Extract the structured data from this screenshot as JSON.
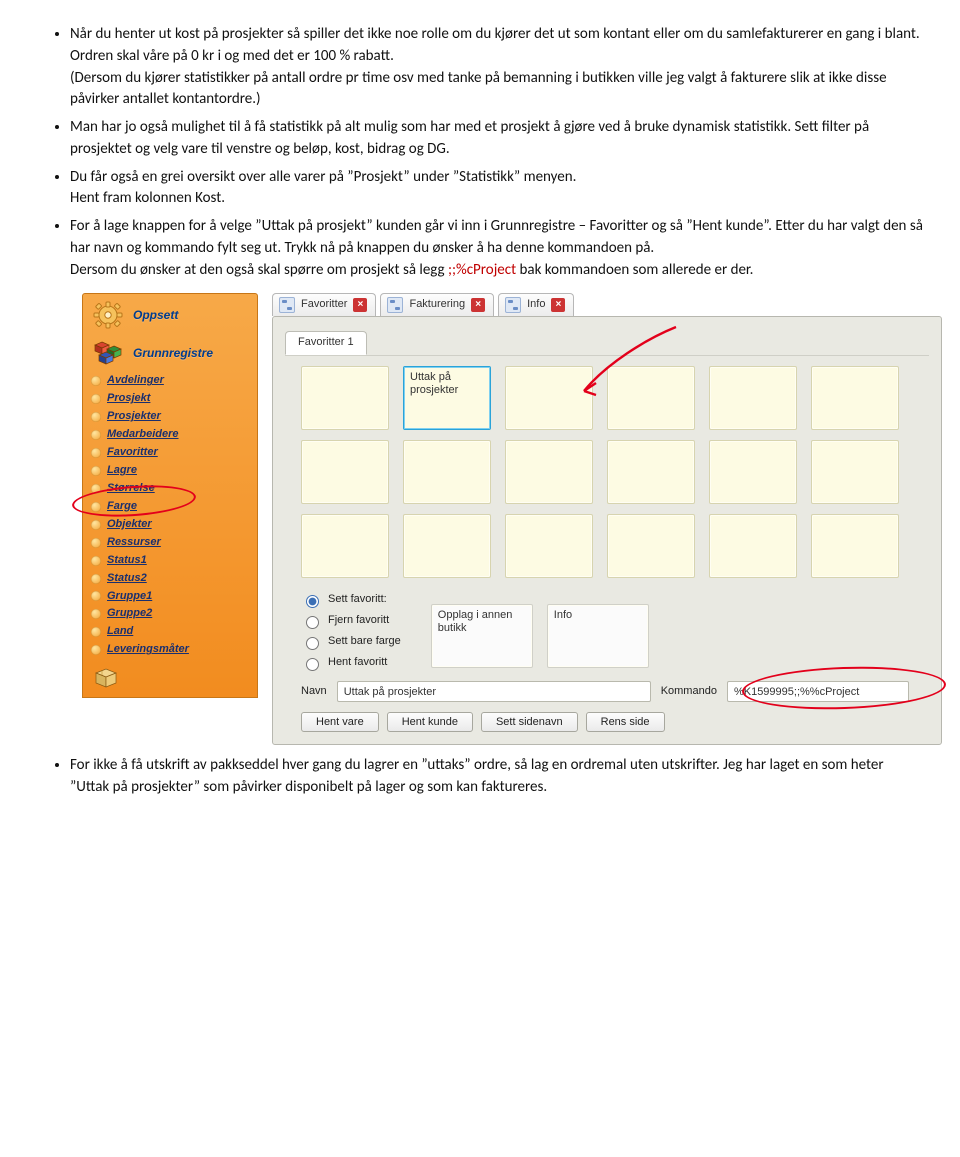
{
  "bullets": {
    "b1_p1": "Når du henter ut kost på prosjekter så spiller det ikke noe rolle om du kjører det ut som kontant eller om du samlefakturerer en gang i blant. Ordren skal våre på 0 kr i og med det er 100 % rabatt.",
    "b1_p2": "(Dersom du kjører statistikker på antall ordre pr time osv med tanke på bemanning i butikken ville jeg valgt å fakturere slik at ikke disse påvirker antallet kontantordre.)",
    "b2": "Man har jo også mulighet til å få statistikk på alt mulig som har med et prosjekt å gjøre ved å bruke dynamisk statistikk. Sett filter på prosjektet og velg vare til venstre og beløp, kost, bidrag og DG.",
    "b3_p1": "Du får også en grei oversikt over alle varer på ”Prosjekt” under ”Statistikk” menyen.",
    "b3_p2": "Hent fram kolonnen Kost.",
    "b4_p1": "For å lage knappen for å velge ”Uttak på prosjekt” kunden går vi  inn i Grunnregistre – Favoritter og så ”Hent kunde”. Etter du har valgt den så har navn og kommando fylt seg ut. Trykk nå på knappen du ønsker å ha denne kommandoen på.",
    "b4_p2a": "Dersom du ønsker at den også skal spørre om prosjekt så legg ",
    "b4_p2b": ";;%cProject",
    "b4_p2c": " bak kommandoen som allerede er der.",
    "b_last": "For ikke å få utskrift av pakkseddel hver gang du lagrer en ”uttaks” ordre, så lag en ordremal uten utskrifter. Jeg har laget en som heter ”Uttak på prosjekter” som påvirker disponibelt på lager og som kan faktureres."
  },
  "sidebar": {
    "oppsett": "Oppsett",
    "grunnregistre": "Grunnregistre",
    "items": [
      "Avdelinger",
      "Prosjekt",
      "Prosjekter",
      "Medarbeidere",
      "Favoritter",
      "Lagre",
      "Størrelse",
      "Farge",
      "Objekter",
      "Ressurser",
      "Status1",
      "Status2",
      "Gruppe1",
      "Gruppe2",
      "Land",
      "Leveringsmåter"
    ]
  },
  "tabs": {
    "t1": "Favoritter",
    "t2": "Fakturering",
    "t3": "Info"
  },
  "subtab": "Favoritter 1",
  "cells": {
    "sel": "Uttak på prosjekter",
    "opplag": "Opplag i annen butikk",
    "info": "Info"
  },
  "radios": {
    "r1": "Sett favoritt:",
    "r2": "Fjern favoritt",
    "r3": "Sett bare farge",
    "r4": "Hent favoritt"
  },
  "labels": {
    "navn": "Navn",
    "kommando": "Kommando"
  },
  "inputs": {
    "navn": "Uttak på prosjekter",
    "kommando": "%K1599995;;%%cProject"
  },
  "buttons": {
    "b1": "Hent vare",
    "b2": "Hent kunde",
    "b3": "Sett sidenavn",
    "b4": "Rens side"
  }
}
